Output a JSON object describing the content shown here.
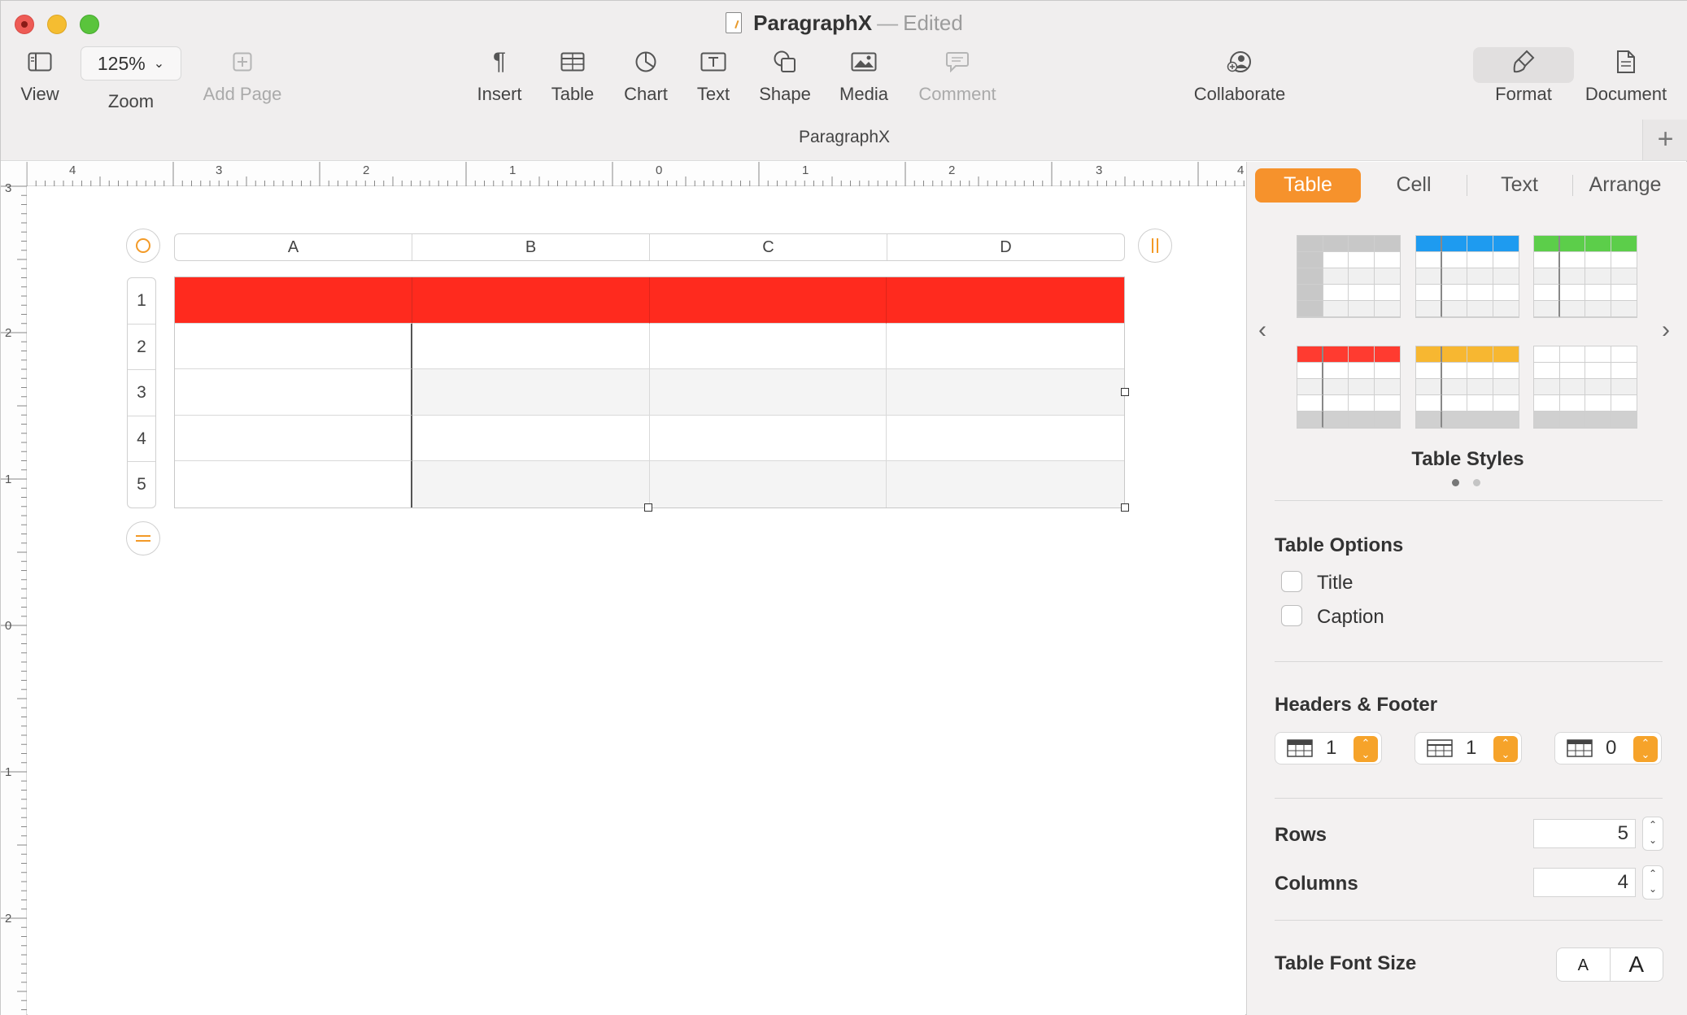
{
  "window": {
    "doc_title": "ParagraphX",
    "separator": "—",
    "status": "Edited",
    "doc_name_bar": "ParagraphX"
  },
  "toolbar": {
    "view": "View",
    "zoom_value": "125%",
    "zoom": "Zoom",
    "add_page": "Add Page",
    "insert": "Insert",
    "table": "Table",
    "chart": "Chart",
    "text": "Text",
    "shape": "Shape",
    "media": "Media",
    "comment": "Comment",
    "collaborate": "Collaborate",
    "format": "Format",
    "document": "Document"
  },
  "ruler": {
    "horizontal": [
      "4",
      "3",
      "2",
      "1",
      "0",
      "1",
      "2",
      "3",
      "4"
    ],
    "vertical": [
      "3",
      "2",
      "1",
      "0",
      "1",
      "2"
    ]
  },
  "table": {
    "columns": [
      "A",
      "B",
      "C",
      "D"
    ],
    "rows": [
      "1",
      "2",
      "3",
      "4",
      "5"
    ],
    "header_color": "#ff2a1e"
  },
  "inspector": {
    "tabs": [
      "Table",
      "Cell",
      "Text",
      "Arrange"
    ],
    "active_tab": "Table",
    "table_styles_label": "Table Styles",
    "style_colors": [
      "#c8c8c8",
      "#1e9bf0",
      "#5cce4a",
      "#ff3b30",
      "#f7b731",
      "#ffffff"
    ],
    "table_options_title": "Table Options",
    "options": [
      {
        "label": "Title",
        "checked": false
      },
      {
        "label": "Caption",
        "checked": false
      }
    ],
    "headers_footer_title": "Headers & Footer",
    "header_rows": "1",
    "header_columns": "1",
    "footer_rows": "0",
    "rows_label": "Rows",
    "rows_value": "5",
    "columns_label": "Columns",
    "columns_value": "4",
    "font_size_label": "Table Font Size",
    "font_small": "A",
    "font_big": "A"
  }
}
